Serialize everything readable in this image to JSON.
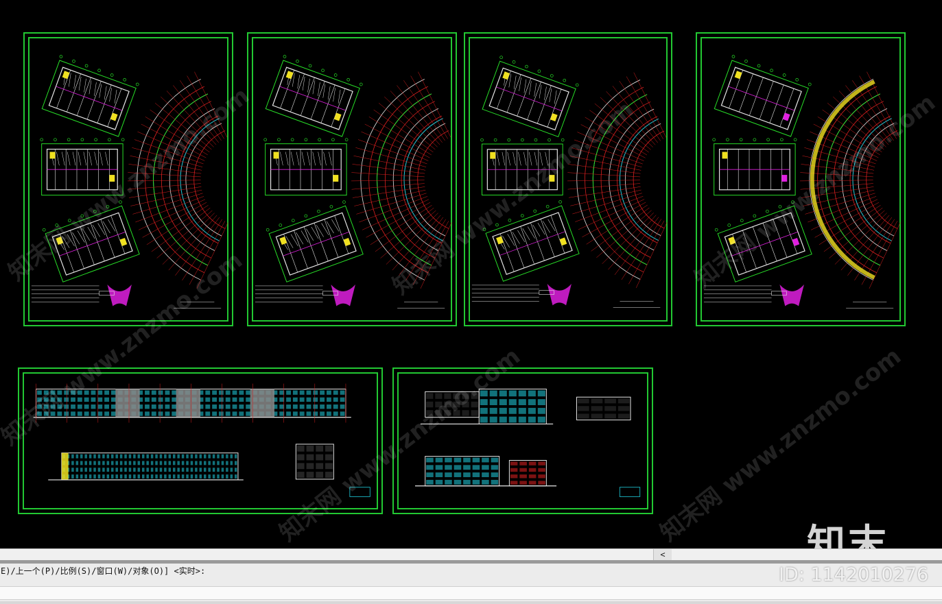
{
  "canvas": {
    "background": "#000000",
    "frame_color": "#22c832",
    "sheets": [
      {
        "id": "plan-1",
        "kind": "floor-plan"
      },
      {
        "id": "plan-2",
        "kind": "floor-plan"
      },
      {
        "id": "plan-3",
        "kind": "floor-plan"
      },
      {
        "id": "plan-4",
        "kind": "floor-plan"
      },
      {
        "id": "elev-1",
        "kind": "elevation"
      },
      {
        "id": "elev-2",
        "kind": "elevation"
      }
    ],
    "colors": {
      "grid_red": "#e02020",
      "wall_white": "#e8e8e8",
      "dim_green": "#28e028",
      "cyan": "#20d0e0",
      "magenta": "#e020e0",
      "yellow": "#f0e020",
      "blue": "#3050ff"
    }
  },
  "watermark": {
    "text": "知末网 www.znzmo.com"
  },
  "logo": {
    "text": "知末"
  },
  "id_label": {
    "text": "ID: 1142010276"
  },
  "scrollbar": {
    "left_arrow": "<"
  },
  "command_line": {
    "history": "E)/上一个(P)/比例(S)/窗口(W)/对象(O)] <实时>:",
    "input": ""
  }
}
